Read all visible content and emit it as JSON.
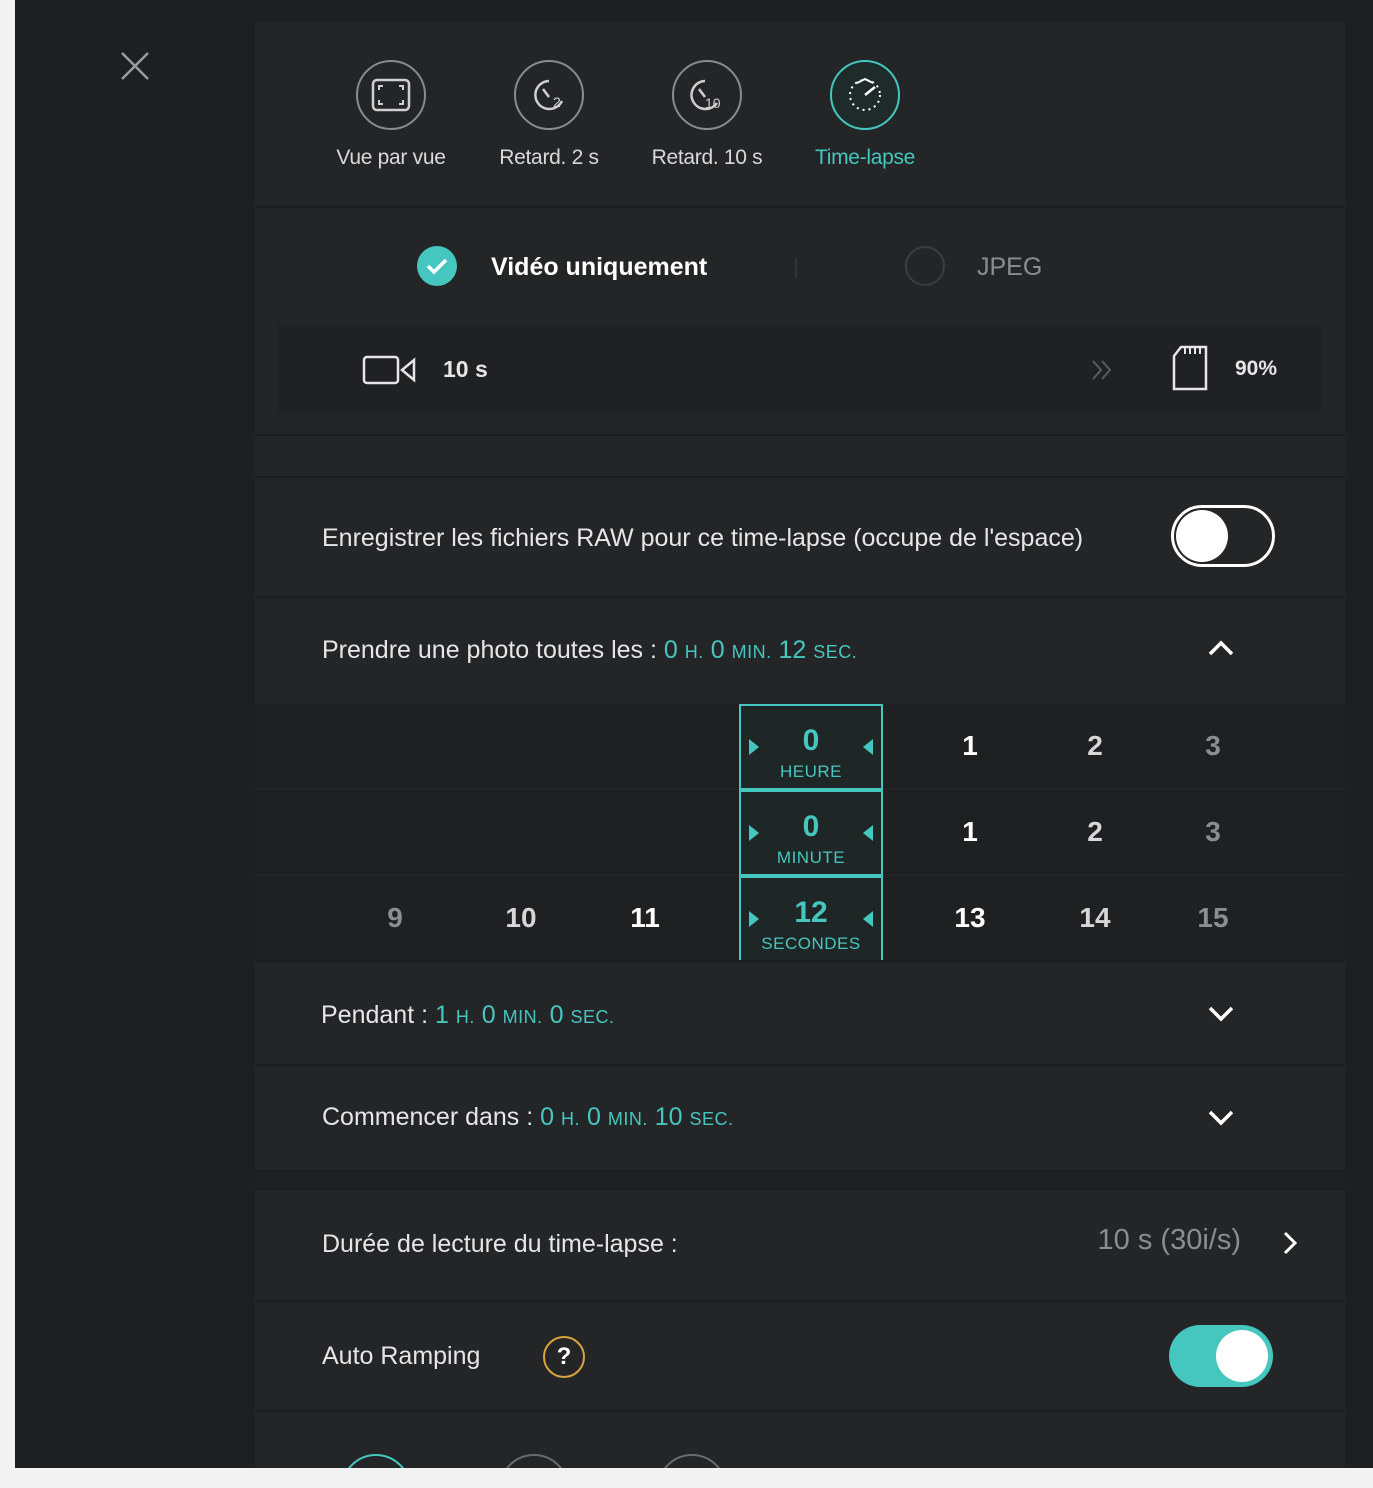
{
  "colors": {
    "accent": "#45c7c0",
    "background": "#1e1f21",
    "panel": "#242527",
    "help": "#d9a53a"
  },
  "modes": [
    {
      "label": "Vue par vue",
      "icon": "single-frame-icon",
      "active": false
    },
    {
      "label": "Retard. 2 s",
      "icon": "timer-2s-icon",
      "active": false
    },
    {
      "label": "Retard. 10 s",
      "icon": "timer-10s-icon",
      "active": false
    },
    {
      "label": "Time-lapse",
      "icon": "timelapse-icon",
      "active": true
    }
  ],
  "format": {
    "video_only": {
      "label": "Vidéo uniquement",
      "selected": true
    },
    "jpeg": {
      "label": "JPEG",
      "selected": false
    }
  },
  "info": {
    "video_duration": "10 s",
    "storage": "90%"
  },
  "raw": {
    "label": "Enregistrer les fichiers RAW pour ce time-lapse (occupe de l'espace)",
    "enabled": false
  },
  "interval": {
    "label": "Prendre une photo toutes les :",
    "h": "0",
    "h_unit": "H.",
    "m": "0",
    "m_unit": "MIN.",
    "s": "12",
    "s_unit": "SEC.",
    "expanded": true
  },
  "picker": {
    "hours": {
      "selected": "0",
      "unit": "HEURE",
      "after": [
        "1",
        "2",
        "3"
      ]
    },
    "minutes": {
      "selected": "0",
      "unit": "MINUTE",
      "after": [
        "1",
        "2",
        "3"
      ]
    },
    "seconds": {
      "selected": "12",
      "unit": "SECONDES",
      "before": [
        "9",
        "10",
        "11"
      ],
      "after": [
        "13",
        "14",
        "15"
      ]
    }
  },
  "duration": {
    "label": "Pendant :",
    "h": "1",
    "h_unit": "H.",
    "m": "0",
    "m_unit": "MIN.",
    "s": "0",
    "s_unit": "SEC."
  },
  "start": {
    "label": "Commencer dans :",
    "h": "0",
    "h_unit": "H.",
    "m": "0",
    "m_unit": "MIN.",
    "s": "10",
    "s_unit": "SEC."
  },
  "playback": {
    "label": "Durée de lecture du time-lapse :",
    "value": "10 s (30i/s)"
  },
  "auto_ramping": {
    "label": "Auto Ramping",
    "help": "?",
    "enabled": true
  }
}
